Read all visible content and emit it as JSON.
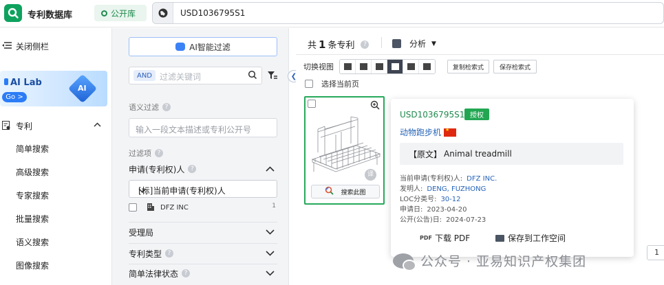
{
  "header": {
    "app_title": "专利数据库",
    "database_badge": "公开库",
    "search_value": "USD1036795S1",
    "brand_color": "#0ea25e"
  },
  "leftnav": {
    "collapse_label": "关闭侧栏",
    "ailab": {
      "title": "AI Lab",
      "go": "Go >",
      "cube_text": "AI"
    },
    "section_label": "专利",
    "items": [
      "简单搜索",
      "高级搜索",
      "专家搜索",
      "批量搜索",
      "语义搜索",
      "图像搜索"
    ]
  },
  "filter": {
    "ai_filter_label": "AI智能过滤",
    "keyword": {
      "operator": "AND",
      "placeholder": "过滤关键词"
    },
    "semantic_label": "语义过滤",
    "semantic_placeholder": "输入一段文本描述或专利公开号",
    "filter_items_label": "过滤项",
    "applicant_title": "申请(专利权)人",
    "applicant_select": "[标]当前申请(专利权)人",
    "applicant_option": {
      "name": "DFZ INC",
      "count": "1"
    },
    "sections": [
      "受理局",
      "专利类型",
      "简单法律状态"
    ]
  },
  "results": {
    "count_prefix": "共",
    "count": "1",
    "count_suffix": "条专利",
    "analyze_label": "分析",
    "view_label": "切换视图",
    "copy_query_label": "复制检索式",
    "save_query_label": "保存检索式",
    "select_page_label": "选择当前页",
    "thumb_search_label": "搜索此图",
    "translate_badge": "译",
    "page_number": "1",
    "card": {
      "pub_number": "USD1036795S1",
      "status_badge": "授权",
      "title": "动物跑步机",
      "original_label": "【原文】",
      "original_title": "Animal treadmill",
      "meta": [
        {
          "label": "当前申请(专利权)人:",
          "value": "DFZ INC."
        },
        {
          "label": "发明人:",
          "value": "DENG, FUZHONG"
        },
        {
          "label": "LOC分类号:",
          "value": "30-12"
        },
        {
          "label": "申请日:",
          "value": "2023-04-20"
        },
        {
          "label": "公开(公告)日:",
          "value": "2024-07-23"
        }
      ],
      "download_pdf_label": "下载 PDF",
      "save_workspace_label": "保存到工作空间"
    }
  },
  "watermark": "公众号 · 亚易知识产权集团"
}
